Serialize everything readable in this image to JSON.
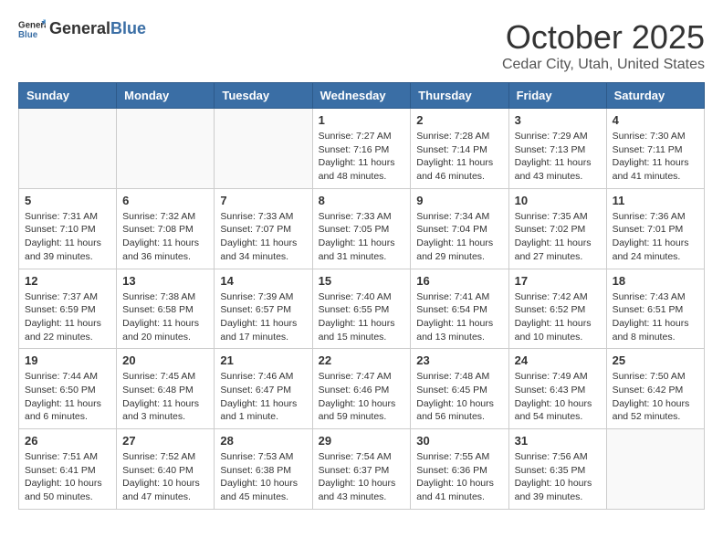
{
  "header": {
    "logo_general": "General",
    "logo_blue": "Blue",
    "month": "October 2025",
    "location": "Cedar City, Utah, United States"
  },
  "days_of_week": [
    "Sunday",
    "Monday",
    "Tuesday",
    "Wednesday",
    "Thursday",
    "Friday",
    "Saturday"
  ],
  "weeks": [
    [
      {
        "day": "",
        "info": ""
      },
      {
        "day": "",
        "info": ""
      },
      {
        "day": "",
        "info": ""
      },
      {
        "day": "1",
        "info": "Sunrise: 7:27 AM\nSunset: 7:16 PM\nDaylight: 11 hours and 48 minutes."
      },
      {
        "day": "2",
        "info": "Sunrise: 7:28 AM\nSunset: 7:14 PM\nDaylight: 11 hours and 46 minutes."
      },
      {
        "day": "3",
        "info": "Sunrise: 7:29 AM\nSunset: 7:13 PM\nDaylight: 11 hours and 43 minutes."
      },
      {
        "day": "4",
        "info": "Sunrise: 7:30 AM\nSunset: 7:11 PM\nDaylight: 11 hours and 41 minutes."
      }
    ],
    [
      {
        "day": "5",
        "info": "Sunrise: 7:31 AM\nSunset: 7:10 PM\nDaylight: 11 hours and 39 minutes."
      },
      {
        "day": "6",
        "info": "Sunrise: 7:32 AM\nSunset: 7:08 PM\nDaylight: 11 hours and 36 minutes."
      },
      {
        "day": "7",
        "info": "Sunrise: 7:33 AM\nSunset: 7:07 PM\nDaylight: 11 hours and 34 minutes."
      },
      {
        "day": "8",
        "info": "Sunrise: 7:33 AM\nSunset: 7:05 PM\nDaylight: 11 hours and 31 minutes."
      },
      {
        "day": "9",
        "info": "Sunrise: 7:34 AM\nSunset: 7:04 PM\nDaylight: 11 hours and 29 minutes."
      },
      {
        "day": "10",
        "info": "Sunrise: 7:35 AM\nSunset: 7:02 PM\nDaylight: 11 hours and 27 minutes."
      },
      {
        "day": "11",
        "info": "Sunrise: 7:36 AM\nSunset: 7:01 PM\nDaylight: 11 hours and 24 minutes."
      }
    ],
    [
      {
        "day": "12",
        "info": "Sunrise: 7:37 AM\nSunset: 6:59 PM\nDaylight: 11 hours and 22 minutes."
      },
      {
        "day": "13",
        "info": "Sunrise: 7:38 AM\nSunset: 6:58 PM\nDaylight: 11 hours and 20 minutes."
      },
      {
        "day": "14",
        "info": "Sunrise: 7:39 AM\nSunset: 6:57 PM\nDaylight: 11 hours and 17 minutes."
      },
      {
        "day": "15",
        "info": "Sunrise: 7:40 AM\nSunset: 6:55 PM\nDaylight: 11 hours and 15 minutes."
      },
      {
        "day": "16",
        "info": "Sunrise: 7:41 AM\nSunset: 6:54 PM\nDaylight: 11 hours and 13 minutes."
      },
      {
        "day": "17",
        "info": "Sunrise: 7:42 AM\nSunset: 6:52 PM\nDaylight: 11 hours and 10 minutes."
      },
      {
        "day": "18",
        "info": "Sunrise: 7:43 AM\nSunset: 6:51 PM\nDaylight: 11 hours and 8 minutes."
      }
    ],
    [
      {
        "day": "19",
        "info": "Sunrise: 7:44 AM\nSunset: 6:50 PM\nDaylight: 11 hours and 6 minutes."
      },
      {
        "day": "20",
        "info": "Sunrise: 7:45 AM\nSunset: 6:48 PM\nDaylight: 11 hours and 3 minutes."
      },
      {
        "day": "21",
        "info": "Sunrise: 7:46 AM\nSunset: 6:47 PM\nDaylight: 11 hours and 1 minute."
      },
      {
        "day": "22",
        "info": "Sunrise: 7:47 AM\nSunset: 6:46 PM\nDaylight: 10 hours and 59 minutes."
      },
      {
        "day": "23",
        "info": "Sunrise: 7:48 AM\nSunset: 6:45 PM\nDaylight: 10 hours and 56 minutes."
      },
      {
        "day": "24",
        "info": "Sunrise: 7:49 AM\nSunset: 6:43 PM\nDaylight: 10 hours and 54 minutes."
      },
      {
        "day": "25",
        "info": "Sunrise: 7:50 AM\nSunset: 6:42 PM\nDaylight: 10 hours and 52 minutes."
      }
    ],
    [
      {
        "day": "26",
        "info": "Sunrise: 7:51 AM\nSunset: 6:41 PM\nDaylight: 10 hours and 50 minutes."
      },
      {
        "day": "27",
        "info": "Sunrise: 7:52 AM\nSunset: 6:40 PM\nDaylight: 10 hours and 47 minutes."
      },
      {
        "day": "28",
        "info": "Sunrise: 7:53 AM\nSunset: 6:38 PM\nDaylight: 10 hours and 45 minutes."
      },
      {
        "day": "29",
        "info": "Sunrise: 7:54 AM\nSunset: 6:37 PM\nDaylight: 10 hours and 43 minutes."
      },
      {
        "day": "30",
        "info": "Sunrise: 7:55 AM\nSunset: 6:36 PM\nDaylight: 10 hours and 41 minutes."
      },
      {
        "day": "31",
        "info": "Sunrise: 7:56 AM\nSunset: 6:35 PM\nDaylight: 10 hours and 39 minutes."
      },
      {
        "day": "",
        "info": ""
      }
    ]
  ]
}
